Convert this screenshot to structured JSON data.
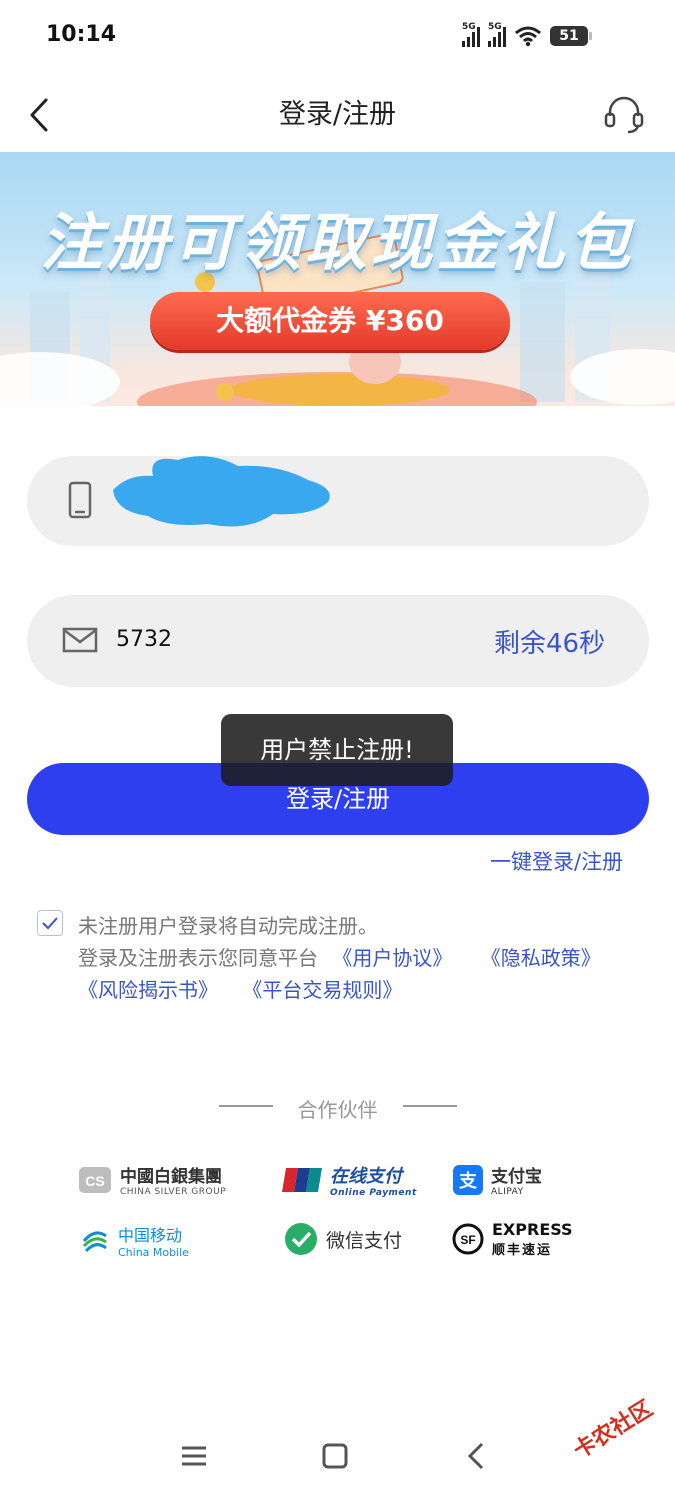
{
  "status_bar": {
    "time": "10:14",
    "network_1": "5G",
    "network_2": "5G",
    "battery": "51"
  },
  "header": {
    "title": "登录/注册"
  },
  "banner": {
    "headline": "注册可领取现金礼包",
    "ribbon": "大额代金券 ¥360"
  },
  "form": {
    "verification_code": "5732",
    "countdown": "剩余46秒",
    "login_label": "登录/注册",
    "one_tap_login": "一键登录/注册"
  },
  "toast": {
    "message": "用户禁止注册!"
  },
  "agreement": {
    "line1": "未注册用户登录将自动完成注册。",
    "line2_prefix": "登录及注册表示您同意平台",
    "links": [
      "《用户协议》",
      "《隐私政策》",
      "《风险揭示书》",
      "《平台交易规则》"
    ]
  },
  "partners": {
    "title": "合作伙伴",
    "items": [
      {
        "name": "中國白銀集團",
        "sub": "CHINA SILVER GROUP"
      },
      {
        "name": "在线支付",
        "sub": "Online Payment",
        "badge": "UnionPay 银联"
      },
      {
        "name": "支付宝",
        "sub": "ALIPAY"
      },
      {
        "name": "中国移动",
        "sub": "China Mobile"
      },
      {
        "name": "微信支付"
      },
      {
        "name": "EXPRESS",
        "sub": "顺丰速运"
      }
    ]
  },
  "watermark": "卡农社区",
  "colors": {
    "primary": "#2e3ff0",
    "link": "#3a55c8",
    "field_bg": "#efefef"
  }
}
